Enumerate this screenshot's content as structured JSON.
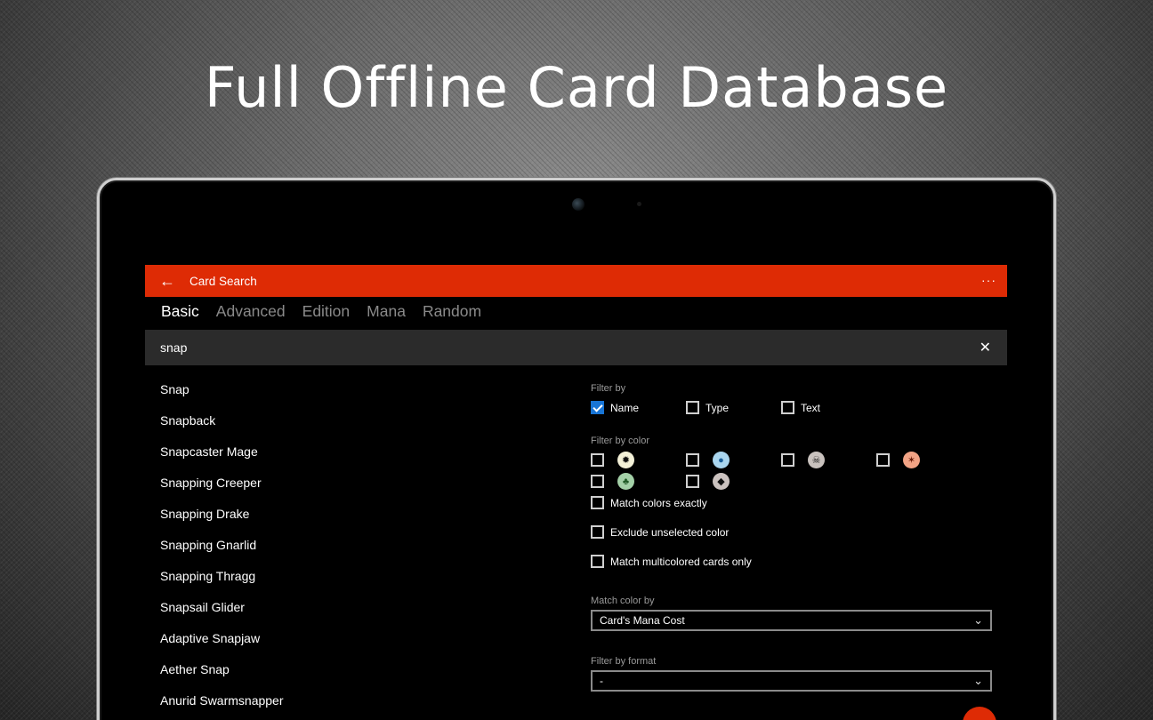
{
  "headline": "Full Offline Card Database",
  "app": {
    "title": "Card Search",
    "back_icon": "←",
    "more_icon": "···"
  },
  "tabs": [
    {
      "label": "Basic",
      "active": true
    },
    {
      "label": "Advanced",
      "active": false
    },
    {
      "label": "Edition",
      "active": false
    },
    {
      "label": "Mana",
      "active": false
    },
    {
      "label": "Random",
      "active": false
    }
  ],
  "search": {
    "value": "snap",
    "clear_icon": "✕"
  },
  "results": [
    "Snap",
    "Snapback",
    "Snapcaster Mage",
    "Snapping Creeper",
    "Snapping Drake",
    "Snapping Gnarlid",
    "Snapping Thragg",
    "Snapsail Glider",
    "Adaptive Snapjaw",
    "Aether Snap",
    "Anurid Swarmsnapper"
  ],
  "filters": {
    "filter_by_label": "Filter by",
    "name_label": "Name",
    "name_checked": true,
    "type_label": "Type",
    "type_checked": false,
    "text_label": "Text",
    "text_checked": false,
    "filter_by_color_label": "Filter by color",
    "colors": [
      {
        "icon": "white-mana-icon",
        "glyph": "✹",
        "bg": "#f4f1d8"
      },
      {
        "icon": "blue-mana-icon",
        "glyph": "●",
        "bg": "#aad6ef"
      },
      {
        "icon": "black-mana-icon",
        "glyph": "☠",
        "bg": "#c9c2be"
      },
      {
        "icon": "red-mana-icon",
        "glyph": "✶",
        "bg": "#f2a385"
      },
      {
        "icon": "green-mana-icon",
        "glyph": "♣",
        "bg": "#a4d1a8"
      },
      {
        "icon": "colorless-mana-icon",
        "glyph": "◆",
        "bg": "#cbc2bf"
      }
    ],
    "match_exactly_label": "Match colors exactly",
    "exclude_unselected_label": "Exclude unselected color",
    "multicolored_only_label": "Match multicolored cards only",
    "match_color_by_label": "Match color by",
    "match_color_by_value": "Card's Mana Cost",
    "filter_by_format_label": "Filter by format",
    "filter_by_format_value": "-",
    "chevron_icon": "⌄"
  },
  "colors": {
    "accent": "#de2b05",
    "checkbox_checked": "#1875d6"
  }
}
